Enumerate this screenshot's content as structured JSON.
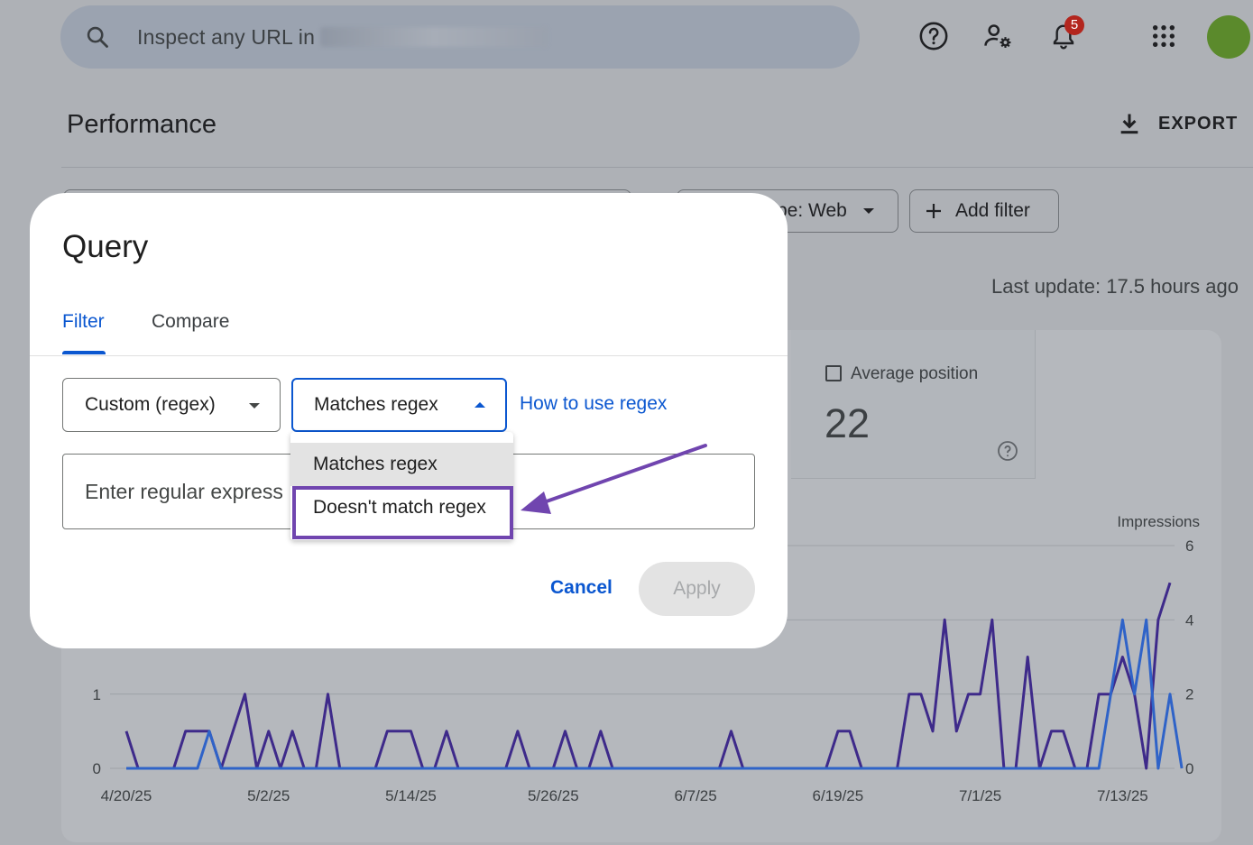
{
  "search": {
    "placeholder": "Inspect any URL in"
  },
  "header": {
    "notifications_count": "5",
    "icons": [
      "search-icon",
      "help-icon",
      "manage-users-icon",
      "notifications-icon",
      "apps-grid-icon"
    ]
  },
  "page": {
    "title": "Performance",
    "export_label": "EXPORT",
    "search_type_chip": "pe: Web",
    "add_filter_label": "Add filter",
    "last_update": "Last update: 17.5 hours ago"
  },
  "metric": {
    "label": "Average position",
    "value": "22"
  },
  "dialog": {
    "title": "Query",
    "tabs": [
      {
        "label": "Filter",
        "active": true
      },
      {
        "label": "Compare",
        "active": false
      }
    ],
    "field_select": "Custom (regex)",
    "match_select": "Matches regex",
    "regex_link": "How to use regex",
    "input_placeholder": "Enter regular express",
    "cancel_label": "Cancel",
    "apply_label": "Apply",
    "menu_options": [
      "Matches regex",
      "Doesn't match regex"
    ],
    "highlighted_option": "Doesn't match regex",
    "annotation_color": "#7045af"
  },
  "chart_data": {
    "type": "line",
    "x_tick_labels": [
      "4/20/25",
      "5/2/25",
      "5/14/25",
      "5/26/25",
      "6/7/25",
      "6/19/25",
      "7/1/25",
      "7/13/25"
    ],
    "left_axis_ticks": [
      "0",
      "1"
    ],
    "right_axis_label": "Impressions",
    "right_axis_ticks": [
      "0",
      "2",
      "4",
      "6"
    ],
    "series": [
      {
        "color": "#3e2a8a",
        "values": [
          1,
          0,
          0,
          0,
          0,
          1,
          1,
          1,
          0,
          1,
          2,
          0,
          1,
          0,
          1,
          0,
          0,
          2,
          0,
          0,
          0,
          0,
          1,
          1,
          1,
          0,
          0,
          1,
          0,
          0,
          0,
          0,
          0,
          1,
          0,
          0,
          0,
          1,
          0,
          0,
          1,
          0,
          0,
          0,
          0,
          0,
          0,
          0,
          0,
          0,
          0,
          1,
          0,
          0,
          0,
          0,
          0,
          0,
          0,
          0,
          1,
          1,
          0,
          0,
          0,
          0,
          2,
          2,
          1,
          4,
          1,
          2,
          2,
          4,
          0,
          0,
          3,
          0,
          1,
          1,
          0,
          0,
          2,
          2,
          3,
          2,
          0,
          4,
          5
        ]
      },
      {
        "color": "#2f63c8",
        "values": [
          0,
          0,
          0,
          0,
          0,
          0,
          0,
          1,
          0,
          0,
          0,
          0,
          0,
          0,
          0,
          0,
          0,
          0,
          0,
          0,
          0,
          0,
          0,
          0,
          0,
          0,
          0,
          0,
          0,
          0,
          0,
          0,
          0,
          0,
          0,
          0,
          0,
          0,
          0,
          0,
          0,
          0,
          0,
          0,
          0,
          0,
          0,
          0,
          0,
          0,
          0,
          0,
          0,
          0,
          0,
          0,
          0,
          0,
          0,
          0,
          0,
          0,
          0,
          0,
          0,
          0,
          0,
          0,
          0,
          0,
          0,
          0,
          0,
          0,
          0,
          0,
          0,
          0,
          0,
          0,
          0,
          0,
          0,
          2,
          4,
          2,
          4,
          0,
          2,
          0
        ]
      }
    ]
  }
}
